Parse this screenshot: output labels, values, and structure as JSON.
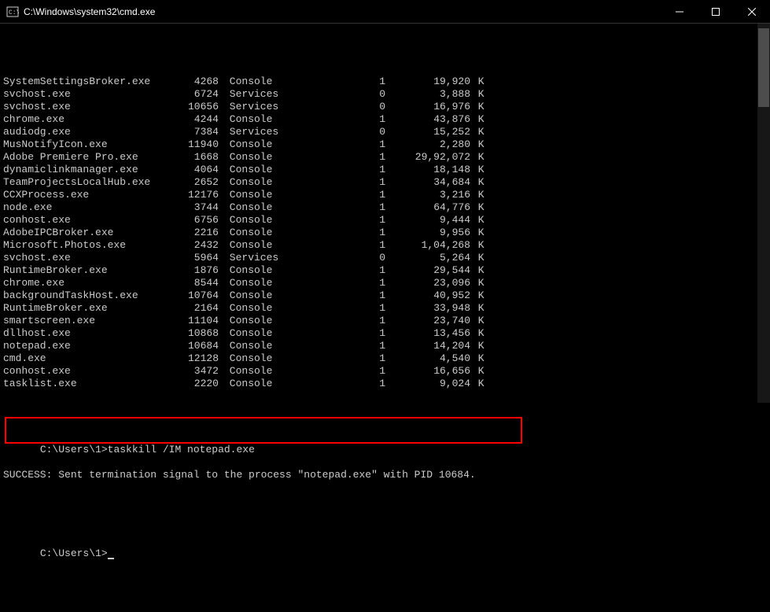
{
  "window": {
    "title": "C:\\Windows\\system32\\cmd.exe"
  },
  "processes": [
    {
      "name": "SystemSettingsBroker.exe",
      "pid": "4268",
      "session": "Console",
      "sessno": "1",
      "mem": "19,920"
    },
    {
      "name": "svchost.exe",
      "pid": "6724",
      "session": "Services",
      "sessno": "0",
      "mem": "3,888"
    },
    {
      "name": "svchost.exe",
      "pid": "10656",
      "session": "Services",
      "sessno": "0",
      "mem": "16,976"
    },
    {
      "name": "chrome.exe",
      "pid": "4244",
      "session": "Console",
      "sessno": "1",
      "mem": "43,876"
    },
    {
      "name": "audiodg.exe",
      "pid": "7384",
      "session": "Services",
      "sessno": "0",
      "mem": "15,252"
    },
    {
      "name": "MusNotifyIcon.exe",
      "pid": "11940",
      "session": "Console",
      "sessno": "1",
      "mem": "2,280"
    },
    {
      "name": "Adobe Premiere Pro.exe",
      "pid": "1668",
      "session": "Console",
      "sessno": "1",
      "mem": "29,92,072"
    },
    {
      "name": "dynamiclinkmanager.exe",
      "pid": "4064",
      "session": "Console",
      "sessno": "1",
      "mem": "18,148"
    },
    {
      "name": "TeamProjectsLocalHub.exe",
      "pid": "2652",
      "session": "Console",
      "sessno": "1",
      "mem": "34,684"
    },
    {
      "name": "CCXProcess.exe",
      "pid": "12176",
      "session": "Console",
      "sessno": "1",
      "mem": "3,216"
    },
    {
      "name": "node.exe",
      "pid": "3744",
      "session": "Console",
      "sessno": "1",
      "mem": "64,776"
    },
    {
      "name": "conhost.exe",
      "pid": "6756",
      "session": "Console",
      "sessno": "1",
      "mem": "9,444"
    },
    {
      "name": "AdobeIPCBroker.exe",
      "pid": "2216",
      "session": "Console",
      "sessno": "1",
      "mem": "9,956"
    },
    {
      "name": "Microsoft.Photos.exe",
      "pid": "2432",
      "session": "Console",
      "sessno": "1",
      "mem": "1,04,268"
    },
    {
      "name": "svchost.exe",
      "pid": "5964",
      "session": "Services",
      "sessno": "0",
      "mem": "5,264"
    },
    {
      "name": "RuntimeBroker.exe",
      "pid": "1876",
      "session": "Console",
      "sessno": "1",
      "mem": "29,544"
    },
    {
      "name": "chrome.exe",
      "pid": "8544",
      "session": "Console",
      "sessno": "1",
      "mem": "23,096"
    },
    {
      "name": "backgroundTaskHost.exe",
      "pid": "10764",
      "session": "Console",
      "sessno": "1",
      "mem": "40,952"
    },
    {
      "name": "RuntimeBroker.exe",
      "pid": "2164",
      "session": "Console",
      "sessno": "1",
      "mem": "33,948"
    },
    {
      "name": "smartscreen.exe",
      "pid": "11104",
      "session": "Console",
      "sessno": "1",
      "mem": "23,740"
    },
    {
      "name": "dllhost.exe",
      "pid": "10868",
      "session": "Console",
      "sessno": "1",
      "mem": "13,456"
    },
    {
      "name": "notepad.exe",
      "pid": "10684",
      "session": "Console",
      "sessno": "1",
      "mem": "14,204"
    },
    {
      "name": "cmd.exe",
      "pid": "12128",
      "session": "Console",
      "sessno": "1",
      "mem": "4,540"
    },
    {
      "name": "conhost.exe",
      "pid": "3472",
      "session": "Console",
      "sessno": "1",
      "mem": "16,656"
    },
    {
      "name": "tasklist.exe",
      "pid": "2220",
      "session": "Console",
      "sessno": "1",
      "mem": "9,024"
    }
  ],
  "mem_unit": "K",
  "cmd1": {
    "prompt": "C:\\Users\\1>",
    "command": "taskkill /IM notepad.exe",
    "output": "SUCCESS: Sent termination signal to the process \"notepad.exe\" with PID 10684."
  },
  "cmd2": {
    "prompt": "C:\\Users\\1>"
  }
}
